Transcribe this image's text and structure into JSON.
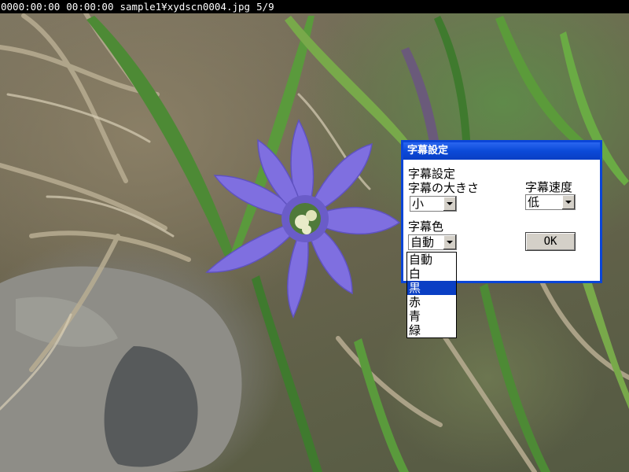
{
  "status_bar": {
    "time_position": "0000:00:00",
    "time_duration": "00:00:00",
    "file_name": "sample1¥xydscn0004.jpg",
    "image_counter": "5/9"
  },
  "photo": {
    "subject_icon": "flower-photo"
  },
  "dialog": {
    "title": "字幕設定",
    "heading": "字幕設定",
    "size_label": "字幕の大きさ",
    "size_value": "小",
    "speed_label": "字幕速度",
    "speed_value": "低",
    "color_label": "字幕色",
    "color_value": "自動",
    "ok_label": "OK"
  },
  "color_dropdown": {
    "options": [
      "自動",
      "白",
      "黒",
      "赤",
      "青",
      "緑"
    ],
    "highlighted": "黒"
  },
  "colors": {
    "titlebar": "#0b4ad8",
    "highlight": "#0a3fc4",
    "flower": "#7f6fe0"
  }
}
